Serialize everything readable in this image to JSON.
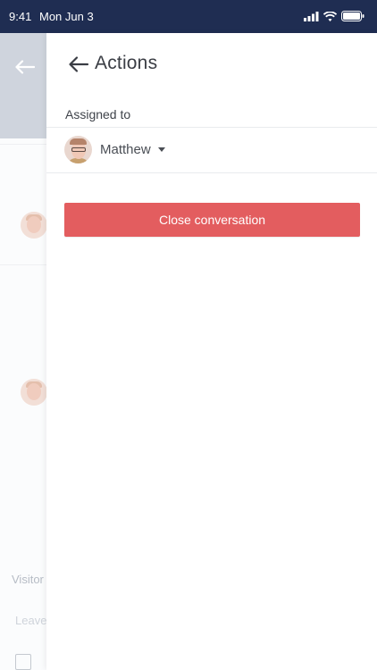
{
  "status_bar": {
    "time": "9:41",
    "date": "Mon Jun 3"
  },
  "background": {
    "visitor_text": "Visitor",
    "leave_text": "Leave"
  },
  "drawer": {
    "title": "Actions",
    "assigned_label": "Assigned to",
    "assignee_name": "Matthew",
    "close_button_label": "Close conversation"
  },
  "colors": {
    "status_bar_bg": "#1f2d52",
    "close_button_bg": "#e35d5f",
    "header_overlay": "#cfd4dd"
  },
  "icons": {
    "back": "arrow-left-icon",
    "dropdown": "caret-down-icon",
    "signal": "cellular-signal-icon",
    "wifi": "wifi-icon",
    "battery": "battery-icon",
    "note": "note-icon"
  }
}
